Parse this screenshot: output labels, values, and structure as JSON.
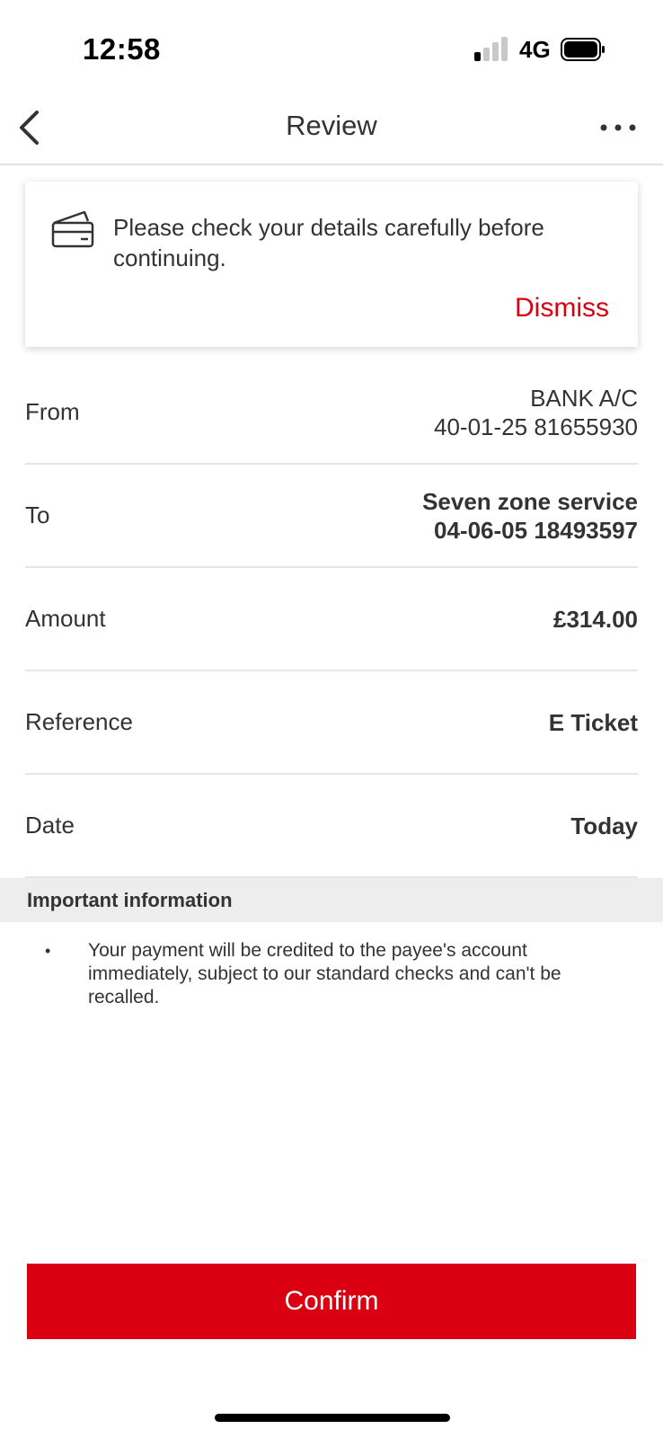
{
  "status_bar": {
    "time": "12:58",
    "network": "4G",
    "signal_bars_active": 1,
    "signal_bars_total": 4,
    "battery_level": 0.8
  },
  "nav": {
    "title": "Review",
    "back_icon": "chevron-left-icon",
    "more_icon": "more-horizontal-icon"
  },
  "notice": {
    "icon": "card-icon",
    "message": "Please check your details carefully before continuing.",
    "dismiss_label": "Dismiss"
  },
  "details": [
    {
      "label": "From",
      "value_line1": "BANK A/C",
      "value_line2": "40-01-25 81655930"
    },
    {
      "label": "To",
      "value_line1": "Seven zone service",
      "value_line2": "04-06-05 18493597"
    },
    {
      "label": "Amount",
      "value_line1": "£314.00",
      "value_line2": ""
    },
    {
      "label": "Reference",
      "value_line1": "E Ticket",
      "value_line2": ""
    },
    {
      "label": "Date",
      "value_line1": "Today",
      "value_line2": ""
    }
  ],
  "important_info": {
    "title": "Important information",
    "bullet": "•",
    "items": [
      "Your payment will be credited to the payee's account immediately, subject to our standard checks and can't be recalled."
    ]
  },
  "confirm_label": "Confirm",
  "colors": {
    "brand_red": "#db0011",
    "text": "#333333",
    "divider": "#e5e5e5",
    "section_bg": "#ededed"
  }
}
